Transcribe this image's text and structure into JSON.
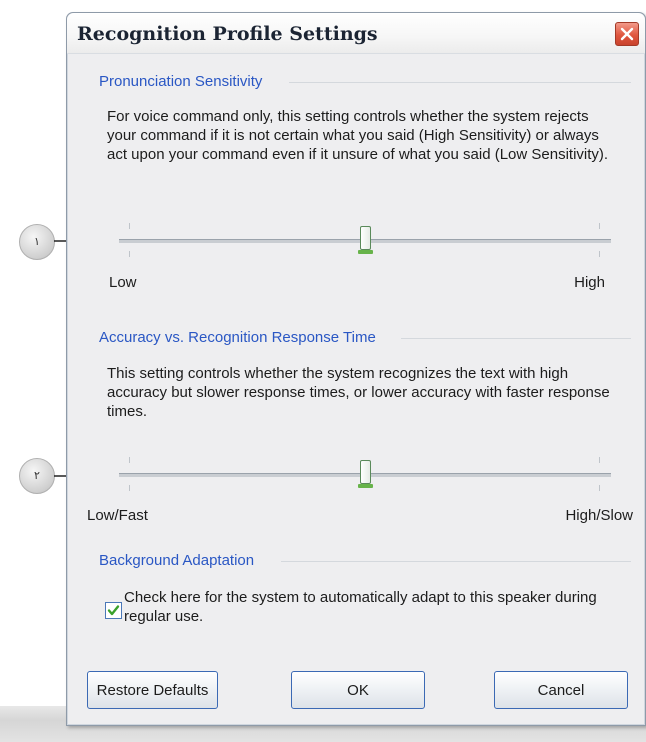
{
  "dialog": {
    "title": "Recognition Profile Settings"
  },
  "pronunciation": {
    "legend": "Pronunciation Sensitivity",
    "description": "For voice command only, this setting controls whether the system rejects your command if it is not certain what you said (High Sensitivity) or always act upon your command even if it unsure of what you said (Low Sensitivity).",
    "low_label": "Low",
    "high_label": "High",
    "level": 0.5,
    "callout": "۱"
  },
  "accuracy": {
    "legend": "Accuracy vs. Recognition Response Time",
    "description": "This setting controls whether the system recognizes the text with high accuracy but slower response times, or lower accuracy with faster response times.",
    "low_label": "Low/Fast",
    "high_label": "High/Slow",
    "level": 0.5,
    "callout": "۲"
  },
  "background": {
    "legend": "Background Adaptation",
    "checkbox_label": "Check here for the system to automatically adapt to this speaker during regular use.",
    "checked": true
  },
  "buttons": {
    "restore": "Restore Defaults",
    "ok": "OK",
    "cancel": "Cancel"
  },
  "icons": {
    "close": "close-icon",
    "check": "checkmark-icon",
    "arrow": "arrow-right-icon"
  },
  "colors": {
    "legend": "#2a57c4",
    "close_button": "#e0573f",
    "button_border": "#3b69b4",
    "checkmark": "#3aa12b",
    "slider_thumb_base": "#67b34a"
  }
}
